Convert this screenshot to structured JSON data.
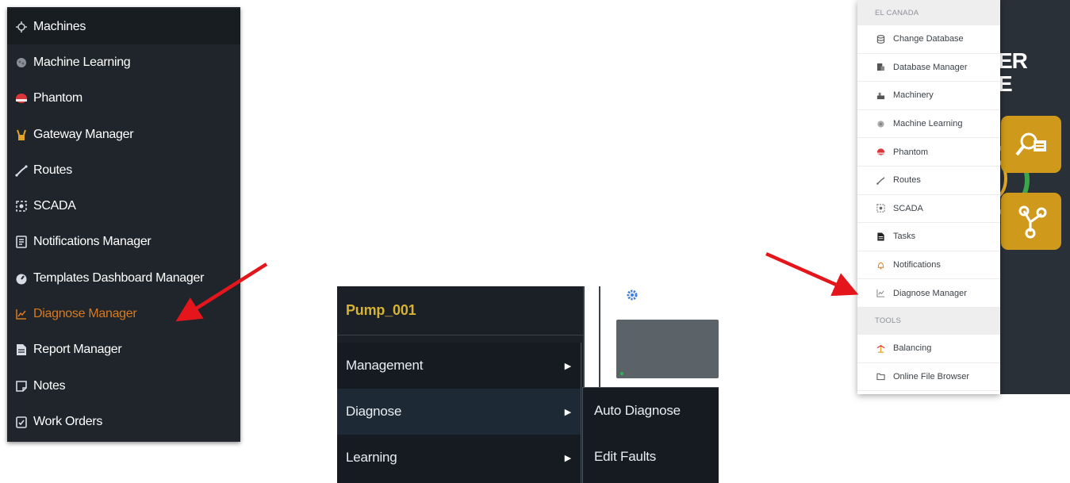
{
  "dark_sidebar": {
    "items": [
      {
        "label": "Machines",
        "icon": "machines-icon"
      },
      {
        "label": "Machine Learning",
        "icon": "brain-icon"
      },
      {
        "label": "Phantom",
        "icon": "phantom-icon"
      },
      {
        "label": "Gateway Manager",
        "icon": "gateway-icon"
      },
      {
        "label": "Routes",
        "icon": "routes-icon"
      },
      {
        "label": "SCADA",
        "icon": "scada-icon"
      },
      {
        "label": "Notifications Manager",
        "icon": "notifications-icon"
      },
      {
        "label": "Templates Dashboard Manager",
        "icon": "templates-icon"
      },
      {
        "label": "Diagnose Manager",
        "icon": "diagnose-icon",
        "active": true
      },
      {
        "label": "Report Manager",
        "icon": "report-icon"
      },
      {
        "label": "Notes",
        "icon": "notes-icon"
      },
      {
        "label": "Work Orders",
        "icon": "work-orders-icon"
      }
    ],
    "active_color": "#d97a1e"
  },
  "context_menu": {
    "title": "Pump_001",
    "items": [
      {
        "label": "Management"
      },
      {
        "label": "Diagnose"
      },
      {
        "label": "Learning"
      }
    ],
    "submenu": [
      {
        "label": "Auto Diagnose"
      },
      {
        "label": "Edit Faults"
      }
    ],
    "title_color": "#d8b233"
  },
  "light_menu": {
    "section_1": "EL CANADA",
    "items_1": [
      {
        "label": "Change Database",
        "icon": "database-icon"
      },
      {
        "label": "Database Manager",
        "icon": "database-manager-icon"
      },
      {
        "label": "Machinery",
        "icon": "machinery-icon"
      },
      {
        "label": "Machine Learning",
        "icon": "brain-icon"
      },
      {
        "label": "Phantom",
        "icon": "phantom-icon"
      },
      {
        "label": "Routes",
        "icon": "routes-icon"
      },
      {
        "label": "SCADA",
        "icon": "scada-icon"
      },
      {
        "label": "Tasks",
        "icon": "tasks-icon"
      },
      {
        "label": "Notifications",
        "icon": "bell-icon"
      },
      {
        "label": "Diagnose Manager",
        "icon": "diagnose-icon"
      }
    ],
    "section_2": "TOOLS",
    "items_2": [
      {
        "label": "Balancing",
        "icon": "balancing-icon"
      },
      {
        "label": "Online File Browser",
        "icon": "folder-icon"
      }
    ],
    "background_logo_text": [
      "ER",
      "E"
    ]
  },
  "colors": {
    "arrow": "#e5161b",
    "tile": "#cf9a1b"
  }
}
